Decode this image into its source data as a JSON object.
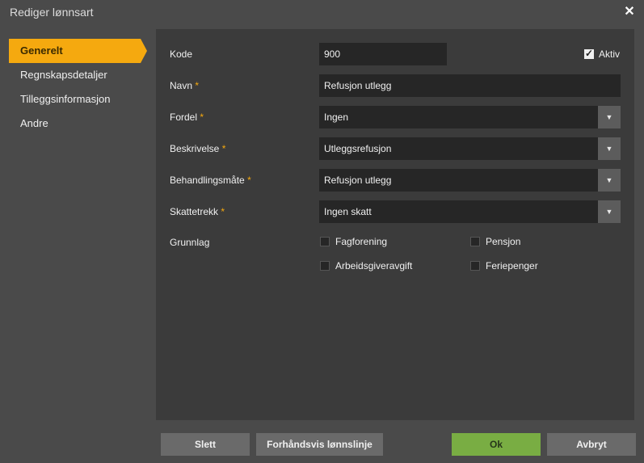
{
  "window": {
    "title": "Rediger lønnsart"
  },
  "sidebar": {
    "items": [
      {
        "label": "Generelt"
      },
      {
        "label": "Regnskapsdetaljer"
      },
      {
        "label": "Tilleggsinformasjon"
      },
      {
        "label": "Andre"
      }
    ]
  },
  "form": {
    "kode": {
      "label": "Kode",
      "value": "900"
    },
    "aktiv": {
      "label": "Aktiv",
      "checked": true
    },
    "navn": {
      "label": "Navn",
      "required": "*",
      "value": "Refusjon utlegg"
    },
    "fordel": {
      "label": "Fordel",
      "required": "*",
      "value": "Ingen"
    },
    "beskrivelse": {
      "label": "Beskrivelse",
      "required": "*",
      "value": "Utleggsrefusjon"
    },
    "behandlingsmate": {
      "label": "Behandlingsmåte",
      "required": "*",
      "value": "Refusjon utlegg"
    },
    "skattetrekk": {
      "label": "Skattetrekk",
      "required": "*",
      "value": "Ingen skatt"
    },
    "grunnlag": {
      "label": "Grunnlag",
      "options": [
        {
          "label": "Fagforening",
          "checked": false
        },
        {
          "label": "Pensjon",
          "checked": false
        },
        {
          "label": "Arbeidsgiveravgift",
          "checked": false
        },
        {
          "label": "Feriepenger",
          "checked": false
        }
      ]
    }
  },
  "footer": {
    "delete_label": "Slett",
    "preview_label": "Forhåndsvis lønnslinje",
    "ok_label": "Ok",
    "cancel_label": "Avbryt"
  },
  "colors": {
    "accent": "#f5a90f",
    "ok_button": "#79ad43",
    "background": "#4a4a4a",
    "panel": "#3b3b3b",
    "field": "#262626"
  }
}
